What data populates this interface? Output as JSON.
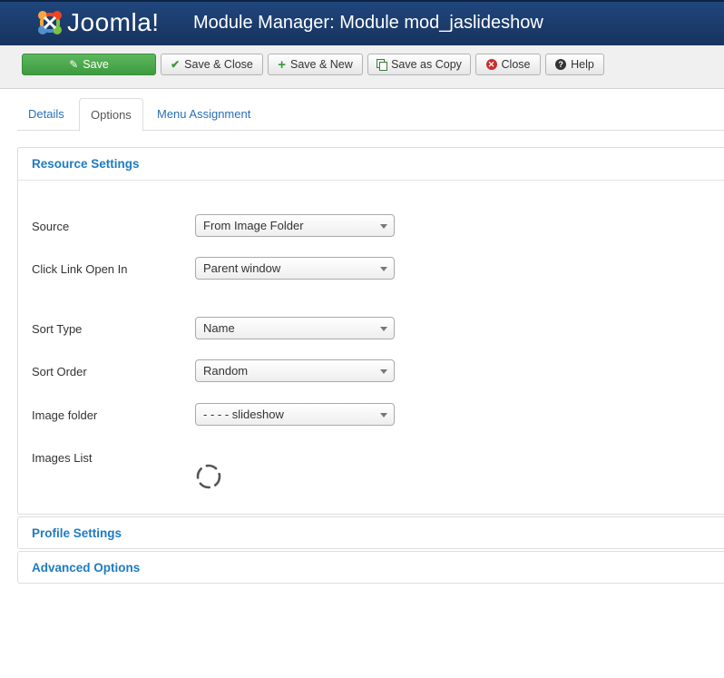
{
  "header": {
    "logo_text": "Joomla!",
    "title": "Module Manager: Module mod_jaslideshow"
  },
  "toolbar": {
    "save": "Save",
    "save_close": "Save & Close",
    "save_new": "Save & New",
    "save_copy": "Save as Copy",
    "close": "Close",
    "help": "Help"
  },
  "tabs": [
    {
      "label": "Details",
      "active": false
    },
    {
      "label": "Options",
      "active": true
    },
    {
      "label": "Menu Assignment",
      "active": false
    }
  ],
  "resource": {
    "heading": "Resource Settings",
    "fields": [
      {
        "label": "Source",
        "value": "From Image Folder"
      },
      {
        "label": "Click Link Open In",
        "value": "Parent window"
      },
      {
        "label": "Sort Type",
        "value": "Name"
      },
      {
        "label": "Sort Order",
        "value": "Random"
      },
      {
        "label": "Image folder",
        "value": "- - - - slideshow"
      }
    ],
    "images_list_label": "Images List"
  },
  "profile": {
    "heading": "Profile Settings"
  },
  "advanced": {
    "heading": "Advanced Options"
  },
  "colors": {
    "header_bg": "#1c3d6f",
    "save_green": "#4cae4c",
    "link_blue": "#1f7bc2"
  }
}
